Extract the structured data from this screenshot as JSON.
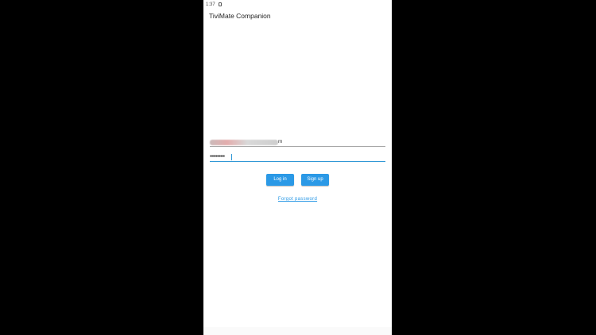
{
  "status_bar": {
    "time": "1:37"
  },
  "app": {
    "title": "TiviMate Companion"
  },
  "login_form": {
    "email_visible_suffix": "m",
    "password_value": "••••••••••"
  },
  "buttons": {
    "login_label": "Log in",
    "signup_label": "Sign up"
  },
  "links": {
    "forgot_password": "Forgot password"
  },
  "colors": {
    "accent": "#2b99e6",
    "frame_background": "#000000",
    "screen_background": "#ffffff"
  }
}
